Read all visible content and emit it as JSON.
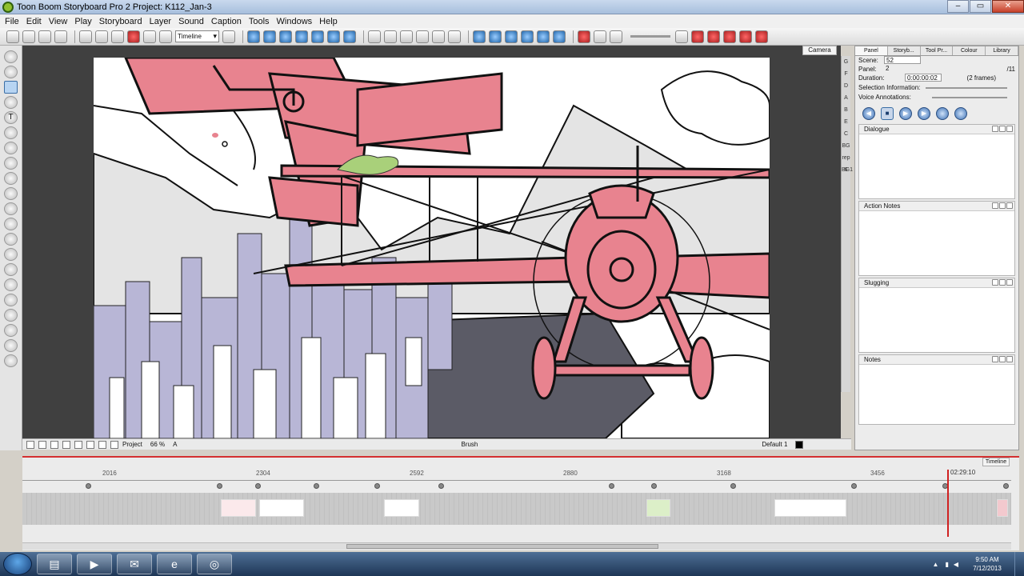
{
  "window": {
    "title": "Toon Boom Storyboard Pro 2 Project: K112_Jan-3",
    "controls": [
      "–",
      "▭",
      "✕"
    ]
  },
  "menu": [
    "File",
    "Edit",
    "View",
    "Play",
    "Storyboard",
    "Layer",
    "Sound",
    "Caption",
    "Tools",
    "Windows",
    "Help"
  ],
  "toolbar": {
    "view_mode": "Timeline"
  },
  "canvas": {
    "camera_tab": "Camera",
    "project_select": "Project",
    "zoom": "66 %",
    "ruler_letter": "A",
    "tool_name": "Brush",
    "layer_name": "Default 1"
  },
  "layer_strip": [
    "G",
    "F",
    "D",
    "A",
    "B",
    "E",
    "C",
    "BG",
    "rep 6",
    "BG1"
  ],
  "panel": {
    "tabs": [
      "Panel",
      "Storyb...",
      "Tool Pr...",
      "Colour",
      "Library"
    ],
    "scene_label": "Scene:",
    "scene_value": "52",
    "panel_label": "Panel:",
    "panel_value": "2",
    "panel_total": "/11",
    "duration_label": "Duration:",
    "duration_value": "0:00:00:02",
    "duration_frames": "(2 frames)",
    "selection_info": "Selection Information:",
    "voice_annotations": "Voice Annotations:",
    "sections": [
      "Dialogue",
      "Action Notes",
      "Slugging",
      "Notes"
    ]
  },
  "timeline": {
    "tab": "Timeline",
    "ruler_labels": [
      "2016",
      "2304",
      "2592",
      "2880",
      "3168",
      "3456"
    ],
    "playhead_time": "02:29:10"
  },
  "taskbar": {
    "time": "9:50 AM",
    "date": "7/12/2013"
  },
  "colors": {
    "accent": "#d43030",
    "plane_pink": "#e8838f",
    "buildings": "#b8b6d6"
  }
}
